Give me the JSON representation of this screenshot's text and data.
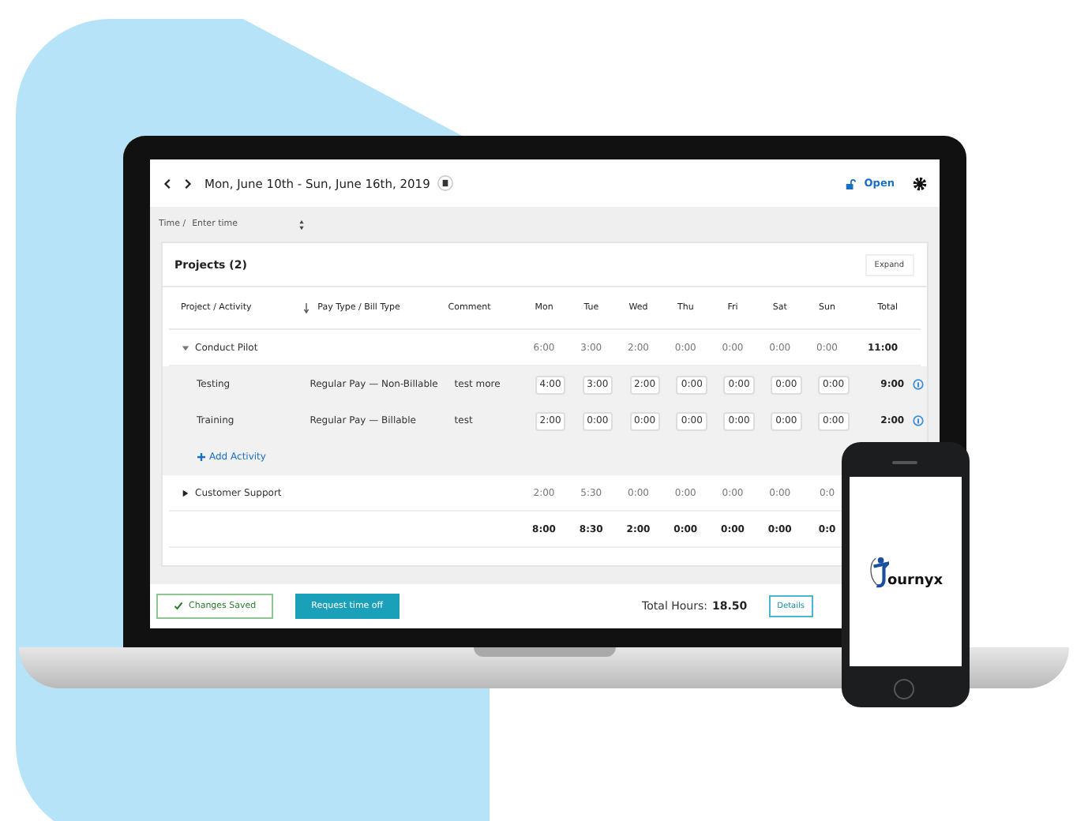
{
  "header": {
    "date_range": "Mon, June 10th - Sun, June 16th, 2019",
    "status": "Open"
  },
  "breadcrumb": {
    "section": "Time /",
    "page": "Enter time"
  },
  "projects": {
    "title": "Projects (2)",
    "expand": "Expand",
    "columns": [
      "Project / Activity",
      "Pay Type / Bill Type",
      "Comment",
      "Mon",
      "Tue",
      "Wed",
      "Thu",
      "Fri",
      "Sat",
      "Sun",
      "Total"
    ],
    "rows": [
      {
        "kind": "group",
        "name": "Conduct Pilot",
        "expanded": true,
        "days": [
          "6:00",
          "3:00",
          "2:00",
          "0:00",
          "0:00",
          "0:00",
          "0:00"
        ],
        "total": "11:00"
      },
      {
        "kind": "activity",
        "name": "Testing",
        "pay_type": "Regular Pay — Non-Billable",
        "comment": "test more",
        "days": [
          "4:00",
          "3:00",
          "2:00",
          "0:00",
          "0:00",
          "0:00",
          "0:00"
        ],
        "total": "9:00"
      },
      {
        "kind": "activity",
        "name": "Training",
        "pay_type": "Regular Pay — Billable",
        "comment": "test",
        "days": [
          "2:00",
          "0:00",
          "0:00",
          "0:00",
          "0:00",
          "0:00",
          "0:00"
        ],
        "total": "2:00"
      },
      {
        "kind": "add",
        "name": "Add Activity"
      },
      {
        "kind": "group",
        "name": "Customer Support",
        "expanded": false,
        "days": [
          "2:00",
          "5:30",
          "0:00",
          "0:00",
          "0:00",
          "0:00",
          "0:0"
        ]
      },
      {
        "kind": "totals",
        "days": [
          "8:00",
          "8:30",
          "2:00",
          "0:00",
          "0:00",
          "0:00",
          "0:0"
        ]
      }
    ]
  },
  "footer": {
    "saved": "Changes Saved",
    "request": "Request time off",
    "total_label": "Total Hours:",
    "total_value": "18.50",
    "details": "Details"
  },
  "phone": {
    "logo": "ournyx"
  }
}
